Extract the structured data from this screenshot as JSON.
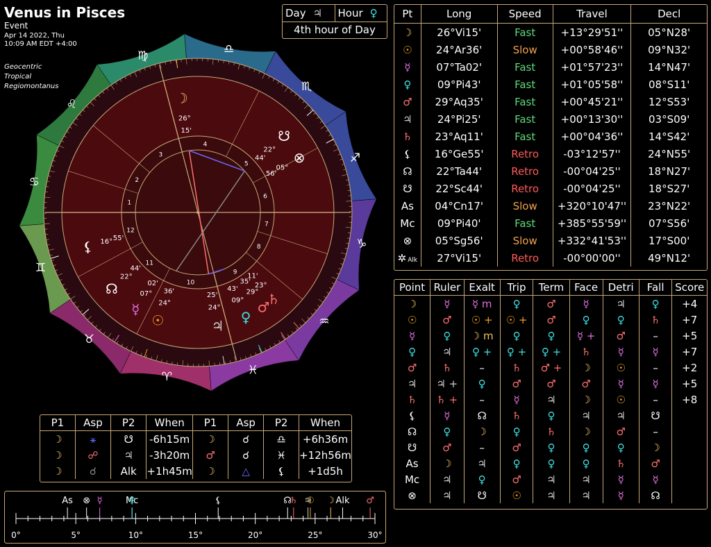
{
  "header": {
    "title": "Venus in Pisces",
    "event": "Event",
    "date": "Apr 14 2022, Thu",
    "time": "10:09 AM EDT +4:00",
    "system": [
      "Geocentric",
      "Tropical",
      "Regiomontanus"
    ]
  },
  "day_hour": {
    "day_label": "Day",
    "day_glyph": "♃",
    "hour_label": "Hour",
    "hour_glyph": "♀",
    "caption": "4th hour of Day"
  },
  "positions": {
    "headers": [
      "Pt",
      "Long",
      "Speed",
      "Travel",
      "Decl"
    ],
    "rows": [
      {
        "glyph": "☽",
        "color": "#f0c060",
        "long": "26°Vi15'",
        "speed": "Fast",
        "travel": "+13°29'51''",
        "decl": "05°N28'"
      },
      {
        "glyph": "☉",
        "color": "#f0a020",
        "long": "24°Ar36'",
        "speed": "Slow",
        "travel": "+00°58'46''",
        "decl": "09°N32'"
      },
      {
        "glyph": "☿",
        "color": "#e070e0",
        "long": "07°Ta02'",
        "speed": "Fast",
        "travel": "+01°57'23''",
        "decl": "14°N47'"
      },
      {
        "glyph": "♀",
        "color": "#40e0e0",
        "long": "09°Pi43'",
        "speed": "Fast",
        "travel": "+01°05'58''",
        "decl": "08°S11'"
      },
      {
        "glyph": "♂",
        "color": "#ff7070",
        "long": "29°Aq35'",
        "speed": "Fast",
        "travel": "+00°45'21''",
        "decl": "12°S53'"
      },
      {
        "glyph": "♃",
        "color": "#d0d0d0",
        "long": "24°Pi25'",
        "speed": "Fast",
        "travel": "+00°13'30''",
        "decl": "03°S09'"
      },
      {
        "glyph": "♄",
        "color": "#ff7070",
        "long": "23°Aq11'",
        "speed": "Fast",
        "travel": "+00°04'36''",
        "decl": "14°S42'"
      },
      {
        "glyph": "⚸",
        "color": "#ffffff",
        "long": "16°Ge55'",
        "speed": "Retro",
        "travel": "-03°12'57''",
        "decl": "24°N55'"
      },
      {
        "glyph": "☊",
        "color": "#ffffff",
        "long": "22°Ta44'",
        "speed": "Retro",
        "travel": "-00°04'25''",
        "decl": "18°N27'"
      },
      {
        "glyph": "☋",
        "color": "#ffffff",
        "long": "22°Sc44'",
        "speed": "Retro",
        "travel": "-00°04'25''",
        "decl": "18°S27'"
      },
      {
        "glyph": "As",
        "color": "#ffffff",
        "long": "04°Cn17'",
        "speed": "Slow",
        "travel": "+320°10'47''",
        "decl": "23°N22'"
      },
      {
        "glyph": "Mc",
        "color": "#ffffff",
        "long": "09°Pi40'",
        "speed": "Fast",
        "travel": "+385°55'59''",
        "decl": "07°S56'"
      },
      {
        "glyph": "⊗",
        "color": "#ffffff",
        "long": "05°Sg56'",
        "speed": "Slow",
        "travel": "+332°41'53''",
        "decl": "17°S00'"
      },
      {
        "glyph": "✲",
        "color": "#ffffff",
        "sub": "Alk",
        "long": "27°Vi15'",
        "speed": "Retro",
        "travel": "-00°00'00''",
        "decl": "49°N12'"
      }
    ]
  },
  "dignities": {
    "headers": [
      "Point",
      "Ruler",
      "Exalt",
      "Trip",
      "Term",
      "Face",
      "Detri",
      "Fall",
      "Score"
    ],
    "rows": [
      [
        "☽",
        "☿",
        "☿ m",
        "♀",
        "♂",
        "☿",
        "♃",
        "♀",
        "+4"
      ],
      [
        "☉",
        "♂",
        "☉ +",
        "☉ +",
        "♂",
        "♀",
        "♀",
        "♄",
        "+7"
      ],
      [
        "☿",
        "♀",
        "☽ m",
        "♀",
        "♀",
        "☿ +",
        "♂",
        "–",
        "+5"
      ],
      [
        "♀",
        "♃",
        "♀ +",
        "♀ +",
        "♀ +",
        "♄",
        "☿",
        "☿",
        "+7"
      ],
      [
        "♂",
        "♄",
        "–",
        "♄",
        "♂ +",
        "☽",
        "☉",
        "–",
        "+2"
      ],
      [
        "♃",
        "♃ +",
        "♀",
        "♂",
        "♂",
        "♂",
        "☿",
        "☿",
        "+5"
      ],
      [
        "♄",
        "♄ +",
        "–",
        "☿",
        "♃",
        "☽",
        "☉",
        "–",
        "+8"
      ],
      [
        "⚸",
        "☿",
        "☊",
        "♄",
        "♀",
        "♃",
        "♃",
        "☋",
        ""
      ],
      [
        "☊",
        "♀",
        "☽",
        "♀",
        "♄",
        "☽",
        "♂",
        "–",
        ""
      ],
      [
        "☋",
        "♂",
        "–",
        "♂",
        "♀",
        "♀",
        "♀",
        "☽",
        ""
      ],
      [
        "As",
        "☽",
        "♃",
        "♀",
        "♀",
        "♀",
        "♄",
        "♂",
        ""
      ],
      [
        "Mc",
        "♃",
        "♀",
        "♂",
        "♃",
        "♃",
        "☿",
        "☿",
        ""
      ],
      [
        "⊗",
        "♃",
        "☋",
        "☉",
        "♃",
        "♃",
        "☿",
        "☊",
        ""
      ]
    ]
  },
  "aspects": {
    "headers": [
      "P1",
      "Asp",
      "P2",
      "When",
      "P1",
      "Asp",
      "P2",
      "When"
    ],
    "rows": [
      [
        {
          "g": "☽",
          "c": "#f0c060"
        },
        {
          "g": "⚹",
          "c": "#6a6aff"
        },
        {
          "g": "☋",
          "c": "#ffffff"
        },
        "-6h15m",
        {
          "g": "☽",
          "c": "#f0c060"
        },
        {
          "g": "☌",
          "c": "#ffffff"
        },
        {
          "g": "♎",
          "c": "#ffffff"
        },
        "+6h36m"
      ],
      [
        {
          "g": "☽",
          "c": "#f0c060"
        },
        {
          "g": "☍",
          "c": "#ff7070"
        },
        {
          "g": "♃",
          "c": "#d0d0d0"
        },
        "-3h20m",
        {
          "g": "♂",
          "c": "#ff7070"
        },
        {
          "g": "☌",
          "c": "#ffffff"
        },
        {
          "g": "♓",
          "c": "#ffffff"
        },
        "+12h56m"
      ],
      [
        {
          "g": "☽",
          "c": "#f0c060"
        },
        {
          "g": "☌",
          "c": "#888888"
        },
        {
          "g": "Alk",
          "c": "#ffffff"
        },
        "+1h45m",
        {
          "g": "☽",
          "c": "#f0c060"
        },
        {
          "g": "△",
          "c": "#6a6aff"
        },
        {
          "g": "⚸",
          "c": "#ffffff"
        },
        "+1d5h"
      ]
    ]
  },
  "degree_strip": {
    "ticks": [
      "0°",
      "5°",
      "10°",
      "15°",
      "20°",
      "25°",
      "30°"
    ],
    "markers": [
      {
        "label": "As",
        "deg": 4.3,
        "color": "#ffffff"
      },
      {
        "label": "⊗",
        "deg": 5.9,
        "color": "#ffffff"
      },
      {
        "label": "☿",
        "deg": 7.0,
        "color": "#e070e0"
      },
      {
        "label": "Mc",
        "deg": 9.7,
        "color": "#ffffff"
      },
      {
        "label": "♀",
        "deg": 9.7,
        "color": "#40e0e0"
      },
      {
        "label": "⚸",
        "deg": 16.9,
        "color": "#ffffff"
      },
      {
        "label": "☊",
        "deg": 22.7,
        "color": "#ffffff"
      },
      {
        "label": "♄",
        "deg": 23.2,
        "color": "#ff7070"
      },
      {
        "label": "♃",
        "deg": 24.4,
        "color": "#d0d0d0"
      },
      {
        "label": "☉",
        "deg": 24.6,
        "color": "#f0a020"
      },
      {
        "label": "☽",
        "deg": 26.3,
        "color": "#f0c060"
      },
      {
        "label": "Alk",
        "deg": 27.3,
        "color": "#ffffff"
      },
      {
        "label": "♂",
        "deg": 29.6,
        "color": "#ff7070"
      }
    ]
  },
  "wheel": {
    "signs": [
      "♈",
      "♉",
      "♊",
      "♋",
      "♌",
      "♍",
      "♎",
      "♏",
      "♐",
      "♑",
      "♒",
      "♓"
    ],
    "sign_colors": [
      "#a0306a",
      "#8a2a6a",
      "#6a9a50",
      "#3a8a40",
      "#2e7a3e",
      "#2a8a6a",
      "#2a6a8a",
      "#3a4a9a",
      "#3a4a9a",
      "#5a3a9a",
      "#7a3aa0",
      "#8a3aa0"
    ],
    "houses": [
      "1",
      "2",
      "3",
      "4",
      "5",
      "6",
      "7",
      "8",
      "9",
      "10",
      "11",
      "12"
    ],
    "asc_deg": 94.28,
    "planets": [
      {
        "g": "☽",
        "deg": 176.25,
        "c": "#f0c060",
        "lbl": "26°",
        "lbl2": "15'"
      },
      {
        "g": "☉",
        "deg": 24.6,
        "c": "#f0a020",
        "lbl": "24°",
        "lbl2": "36'"
      },
      {
        "g": "☿",
        "deg": 37.0,
        "c": "#e070e0",
        "lbl": "07°",
        "lbl2": "02'"
      },
      {
        "g": "♀",
        "deg": 339.7,
        "c": "#40e0e0",
        "lbl": "09°",
        "lbl2": "43'"
      },
      {
        "g": "♂",
        "deg": 329.6,
        "c": "#ff7070",
        "lbl": "29°",
        "lbl2": "35'"
      },
      {
        "g": "♃",
        "deg": 354.4,
        "c": "#d0d0d0",
        "lbl": "24°",
        "lbl2": "25'"
      },
      {
        "g": "♄",
        "deg": 323.2,
        "c": "#ff7070",
        "lbl": "23°",
        "lbl2": "11'"
      },
      {
        "g": "⚸",
        "deg": 76.9,
        "c": "#ffffff",
        "lbl": "16°",
        "lbl2": "55'"
      },
      {
        "g": "☊",
        "deg": 52.7,
        "c": "#ffffff",
        "lbl": "22°",
        "lbl2": "44'"
      },
      {
        "g": "☋",
        "deg": 232.7,
        "c": "#ffffff",
        "lbl": "22°",
        "lbl2": "44'"
      },
      {
        "g": "⊗",
        "deg": 245.9,
        "c": "#ffffff",
        "lbl": "05°",
        "lbl2": "56'"
      }
    ]
  }
}
